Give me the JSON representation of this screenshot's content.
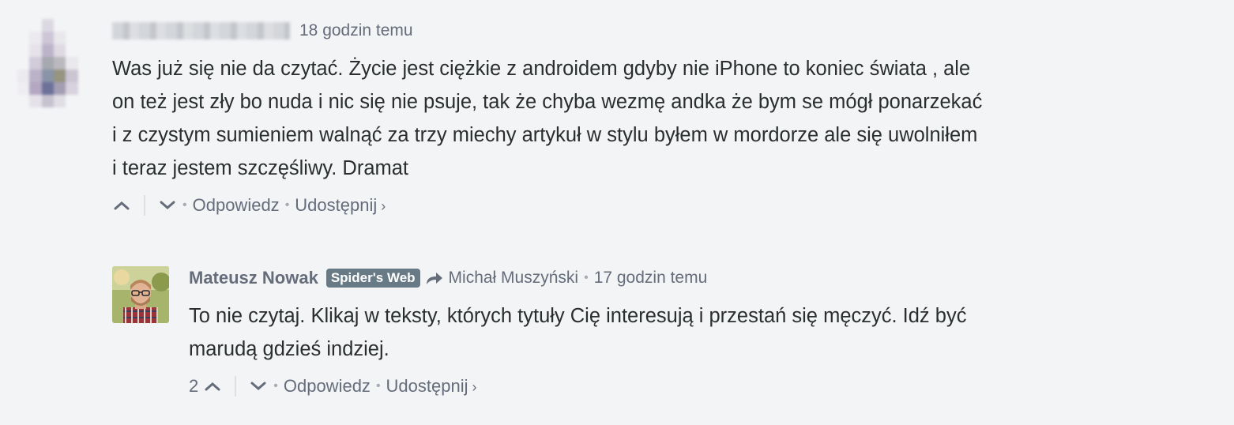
{
  "comments": [
    {
      "time": "18 godzin temu",
      "text_lines": [
        "Was już się nie da czytać. Życie jest ciężkie z androidem gdyby nie iPhone to koniec świata , ale",
        "on też jest zły bo nuda i nic się nie psuje, tak że chyba wezmę andka że bym se mógł ponarzekać",
        "i z czystym sumieniem walnąć za trzy miechy artykuł w stylu byłem w mordorze ale się uwolniłem",
        "i teraz jestem szczęśliwy. Dramat"
      ],
      "reply_label": "Odpowiedz",
      "share_label": "Udostępnij"
    },
    {
      "author": "Mateusz Nowak",
      "badge": "Spider's Web",
      "reply_to": "Michał Muszyński",
      "time": "17 godzin temu",
      "text_lines": [
        "To nie czytaj. Klikaj w teksty, których tytuły Cię interesują i przestań się męczyć. Idź być",
        "marudą gdzieś indziej."
      ],
      "upvotes": "2",
      "reply_label": "Odpowiedz",
      "share_label": "Udostępnij"
    }
  ],
  "separator_dot": "•",
  "chevron": "›",
  "icons": {
    "upvote": "chevron-up-icon",
    "downvote": "chevron-down-icon",
    "reply_to": "reply-arrow-icon",
    "share": "chevron-right-icon"
  },
  "colors": {
    "background": "#f3f4f6",
    "text": "#2a2e2e",
    "meta": "#656c7a",
    "badge": "#687a86"
  }
}
